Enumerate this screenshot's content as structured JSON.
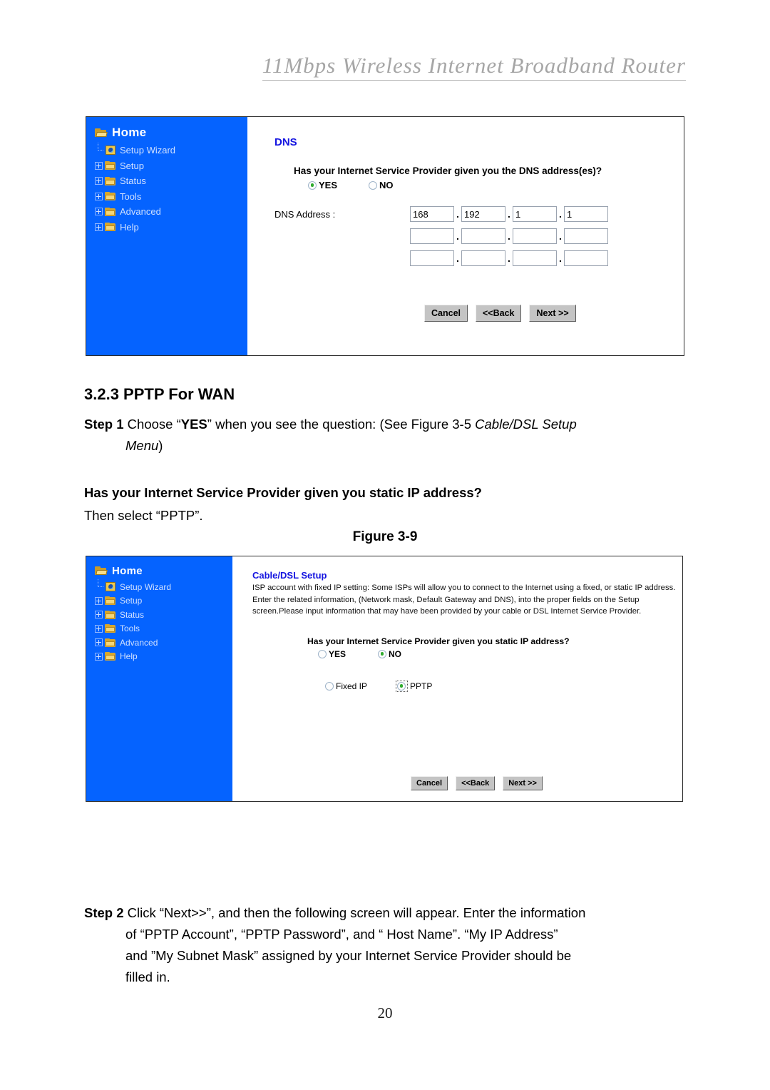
{
  "header": {
    "title": "11Mbps  Wireless  Internet  Broadband  Router"
  },
  "sidebar": {
    "home_label": "Home",
    "items": [
      {
        "label": "Setup Wizard",
        "icon": "wizard-icon",
        "expandable": false
      },
      {
        "label": "Setup",
        "icon": "folder-icon",
        "expandable": true
      },
      {
        "label": "Status",
        "icon": "folder-icon",
        "expandable": true
      },
      {
        "label": "Tools",
        "icon": "folder-icon",
        "expandable": true
      },
      {
        "label": "Advanced",
        "icon": "folder-icon",
        "expandable": true
      },
      {
        "label": "Help",
        "icon": "folder-icon",
        "expandable": true
      }
    ]
  },
  "dns_panel": {
    "title": "DNS",
    "question": "Has your Internet Service Provider given you the DNS address(es)?",
    "yes_label": "YES",
    "no_label": "NO",
    "selected": "YES",
    "address_label": "DNS Address :",
    "rows": [
      [
        "168",
        "192",
        "1",
        "1"
      ],
      [
        "",
        "",
        "",
        ""
      ],
      [
        "",
        "",
        "",
        ""
      ]
    ],
    "separator": ".",
    "buttons": {
      "cancel": "Cancel",
      "back": "<<Back",
      "next": "Next >>"
    }
  },
  "cable_panel": {
    "title": "Cable/DSL Setup",
    "description": "ISP account with fixed IP setting: Some ISPs will allow you to connect to the Internet using a fixed, or static IP address. Enter the related information, (Network mask, Default Gateway and DNS), into the proper fields on the Setup screen.Please input information that may have been provided by your cable or DSL Internet Service Provider.",
    "question": "Has your Internet Service Provider given you static IP address?",
    "yes_label": "YES",
    "no_label": "NO",
    "selected": "NO",
    "fixed_ip_label": "Fixed IP",
    "pptp_label": "PPTP",
    "connection_selected": "PPTP",
    "buttons": {
      "cancel": "Cancel",
      "back": "<<Back",
      "next": "Next >>"
    }
  },
  "document": {
    "section_number": "3.2.3",
    "section_title": "PPTP For WAN",
    "section_heading": "3.2.3 PPTP For WAN",
    "step1_prefix": "Step 1",
    "step1_text_a": " Choose “",
    "step1_yes": "YES",
    "step1_text_b": "” when you see the question: (See Figure 3-5 ",
    "step1_italic": "Cable/DSL Setup",
    "step1_italic2": "Menu",
    "step1_text_c": ")",
    "static_ip_question": "Has your Internet Service Provider given you static IP address?",
    "then_select": "Then select “PPTP”.",
    "figure_label": "Figure 3-9",
    "step2_prefix": "Step 2",
    "step2_line1": " Click “Next>>”, and then the following screen will appear. Enter the information",
    "step2_line2": "of “PPTP Account”, “PPTP Password”, and “ Host Name”. “My IP Address”",
    "step2_line3": "and ”My Subnet Mask” assigned by your Internet Service Provider should be",
    "step2_line4": "filled in.",
    "page_number": "20"
  },
  "colors": {
    "sidebar_blue": "#0563ff",
    "panel_title_blue": "#1414e0",
    "header_gray": "#a6a6a6",
    "radio_green": "#2faa2f",
    "button_gray": "#c4c4c4"
  }
}
